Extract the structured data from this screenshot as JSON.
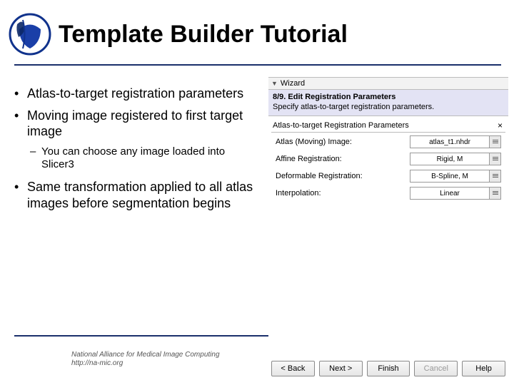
{
  "header": {
    "title": "Template Builder Tutorial"
  },
  "bullets": {
    "b1": "Atlas-to-target registration parameters",
    "b2": "Moving image registered to first target image",
    "b2s1": "You can choose any image loaded into Slicer3",
    "b3": "Same transformation applied to all atlas images before segmentation begins"
  },
  "footer": {
    "line1": "National Alliance for Medical Image Computing",
    "line2": "http://na-mic.org"
  },
  "panel": {
    "title": "Wizard",
    "step_title": "8/9. Edit Registration Parameters",
    "step_desc": "Specify atlas-to-target registration parameters.",
    "group_label": "Atlas-to-target Registration Parameters",
    "params": {
      "atlas_label": "Atlas (Moving) Image:",
      "atlas_value": "atlas_t1.nhdr",
      "affine_label": "Affine Registration:",
      "affine_value": "Rigid, M",
      "deform_label": "Deformable Registration:",
      "deform_value": "B-Spline, M",
      "interp_label": "Interpolation:",
      "interp_value": "Linear"
    },
    "buttons": {
      "back": "< Back",
      "next": "Next >",
      "finish": "Finish",
      "cancel": "Cancel",
      "help": "Help"
    }
  }
}
